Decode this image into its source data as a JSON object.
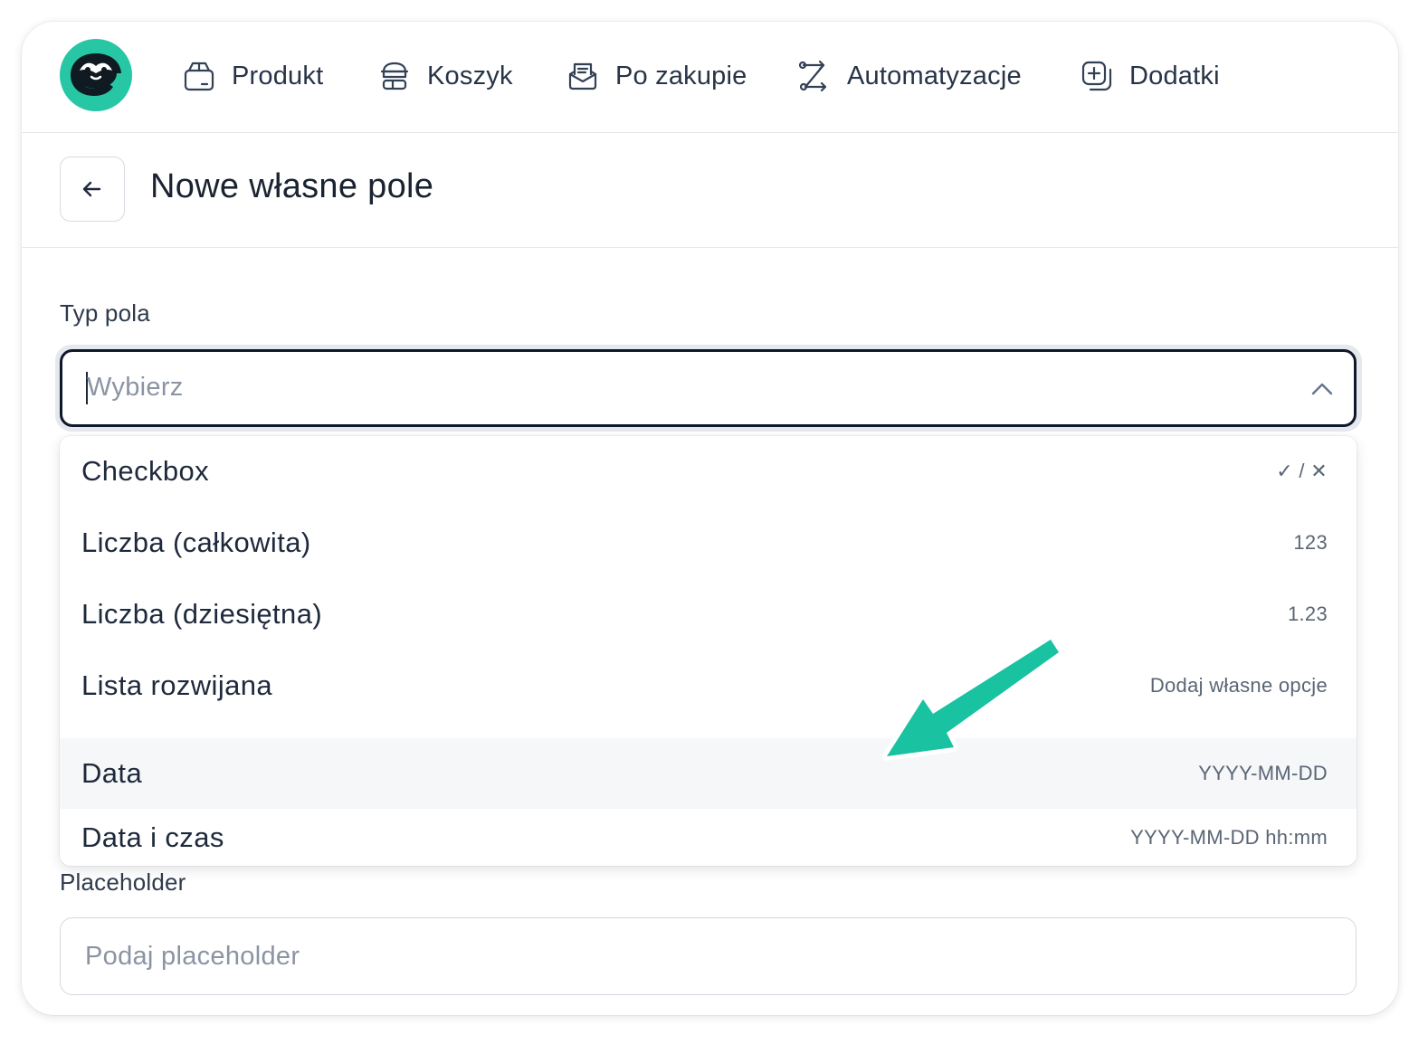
{
  "nav": {
    "items": [
      {
        "label": "Produkt",
        "icon": "box-icon"
      },
      {
        "label": "Koszyk",
        "icon": "cart-stack-icon"
      },
      {
        "label": "Po zakupie",
        "icon": "mail-inbox-icon"
      },
      {
        "label": "Automatyzacje",
        "icon": "route-icon"
      },
      {
        "label": "Dodatki",
        "icon": "add-copy-icon"
      }
    ]
  },
  "header": {
    "title": "Nowe własne pole",
    "back_icon": "arrow-left-icon"
  },
  "form": {
    "field_type": {
      "label": "Typ pola",
      "placeholder": "Wybierz",
      "options": [
        {
          "label": "Checkbox",
          "hint": "✓ / ✕"
        },
        {
          "label": "Liczba (całkowita)",
          "hint": "123"
        },
        {
          "label": "Liczba (dziesiętna)",
          "hint": "1.23"
        },
        {
          "label": "Lista rozwijana",
          "hint": "Dodaj własne opcje"
        },
        {
          "label": "Data",
          "hint": "YYYY-MM-DD"
        },
        {
          "label": "Data i czas",
          "hint": "YYYY-MM-DD hh:mm"
        }
      ],
      "highlighted_option": "Data"
    },
    "placeholder_field": {
      "label": "Placeholder",
      "placeholder": "Podaj placeholder",
      "value": ""
    }
  },
  "colors": {
    "brand": "#27c6a5",
    "annotation_arrow": "#19c2a0",
    "focus_border": "#0f172a"
  }
}
